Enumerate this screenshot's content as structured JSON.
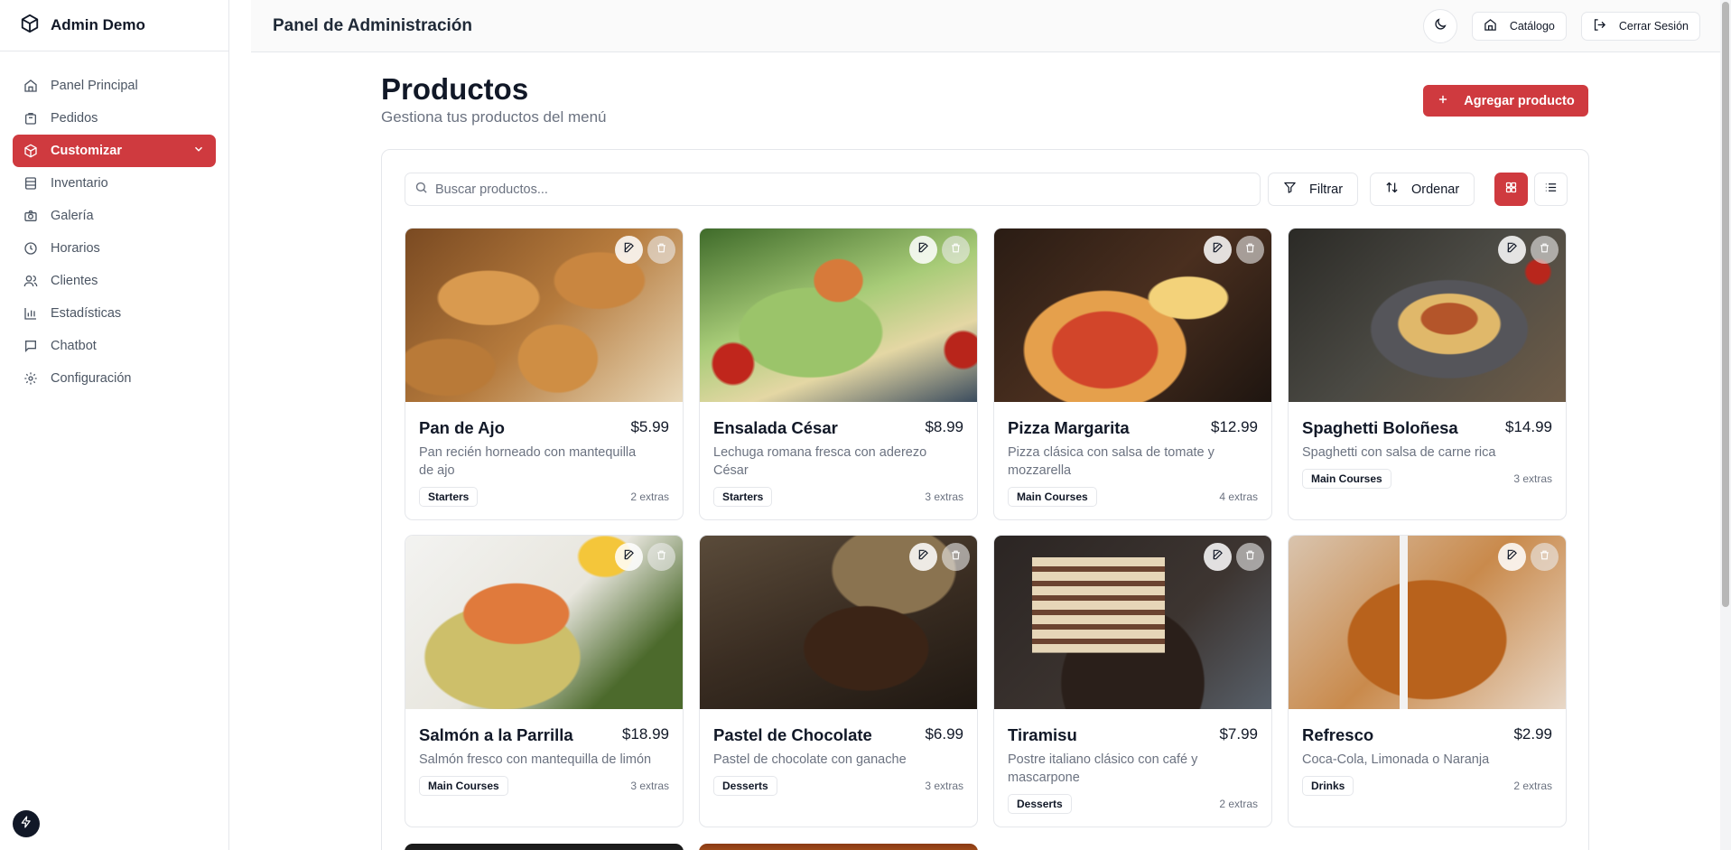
{
  "brand": {
    "name": "Admin Demo",
    "icon": "box-icon"
  },
  "sidebar": {
    "items": [
      {
        "label": "Panel Principal",
        "icon": "home-icon"
      },
      {
        "label": "Pedidos",
        "icon": "bag-icon"
      },
      {
        "label": "Customizar",
        "icon": "package-icon",
        "active": true
      },
      {
        "label": "Inventario",
        "icon": "database-icon"
      },
      {
        "label": "Galería",
        "icon": "camera-icon"
      },
      {
        "label": "Horarios",
        "icon": "clock-icon"
      },
      {
        "label": "Clientes",
        "icon": "users-icon"
      },
      {
        "label": "Estadísticas",
        "icon": "bar-chart-icon"
      },
      {
        "label": "Chatbot",
        "icon": "chat-icon"
      },
      {
        "label": "Configuración",
        "icon": "gear-icon"
      }
    ]
  },
  "header": {
    "title": "Panel de Administración",
    "catalog_label": "Catálogo",
    "logout_label": "Cerrar Sesión"
  },
  "main": {
    "title": "Productos",
    "subtitle": "Gestiona tus productos del menú",
    "add_label": "Agregar producto",
    "search_placeholder": "Buscar productos...",
    "filter_label": "Filtrar",
    "sort_label": "Ordenar"
  },
  "products": [
    {
      "name": "Pan de Ajo",
      "price": "$5.99",
      "desc": "Pan recién horneado con mantequilla de ajo",
      "category": "Starters",
      "extras": "2 extras"
    },
    {
      "name": "Ensalada César",
      "price": "$8.99",
      "desc": "Lechuga romana fresca con aderezo César",
      "category": "Starters",
      "extras": "3 extras"
    },
    {
      "name": "Pizza Margarita",
      "price": "$12.99",
      "desc": "Pizza clásica con salsa de tomate y mozzarella",
      "category": "Main Courses",
      "extras": "4 extras"
    },
    {
      "name": "Spaghetti Boloñesa",
      "price": "$14.99",
      "desc": "Spaghetti con salsa de carne rica",
      "category": "Main Courses",
      "extras": "3 extras"
    },
    {
      "name": "Salmón a la Parrilla",
      "price": "$18.99",
      "desc": "Salmón fresco con mantequilla de limón",
      "category": "Main Courses",
      "extras": "3 extras"
    },
    {
      "name": "Pastel de Chocolate",
      "price": "$6.99",
      "desc": "Pastel de chocolate con ganache",
      "category": "Desserts",
      "extras": "3 extras"
    },
    {
      "name": "Tiramisu",
      "price": "$7.99",
      "desc": "Postre italiano clásico con café y mascarpone",
      "category": "Desserts",
      "extras": "2 extras"
    },
    {
      "name": "Refresco",
      "price": "$2.99",
      "desc": "Coca-Cola, Limonada o Naranja",
      "category": "Drinks",
      "extras": "2 extras"
    }
  ],
  "colors": {
    "accent": "#cf3a3f"
  }
}
